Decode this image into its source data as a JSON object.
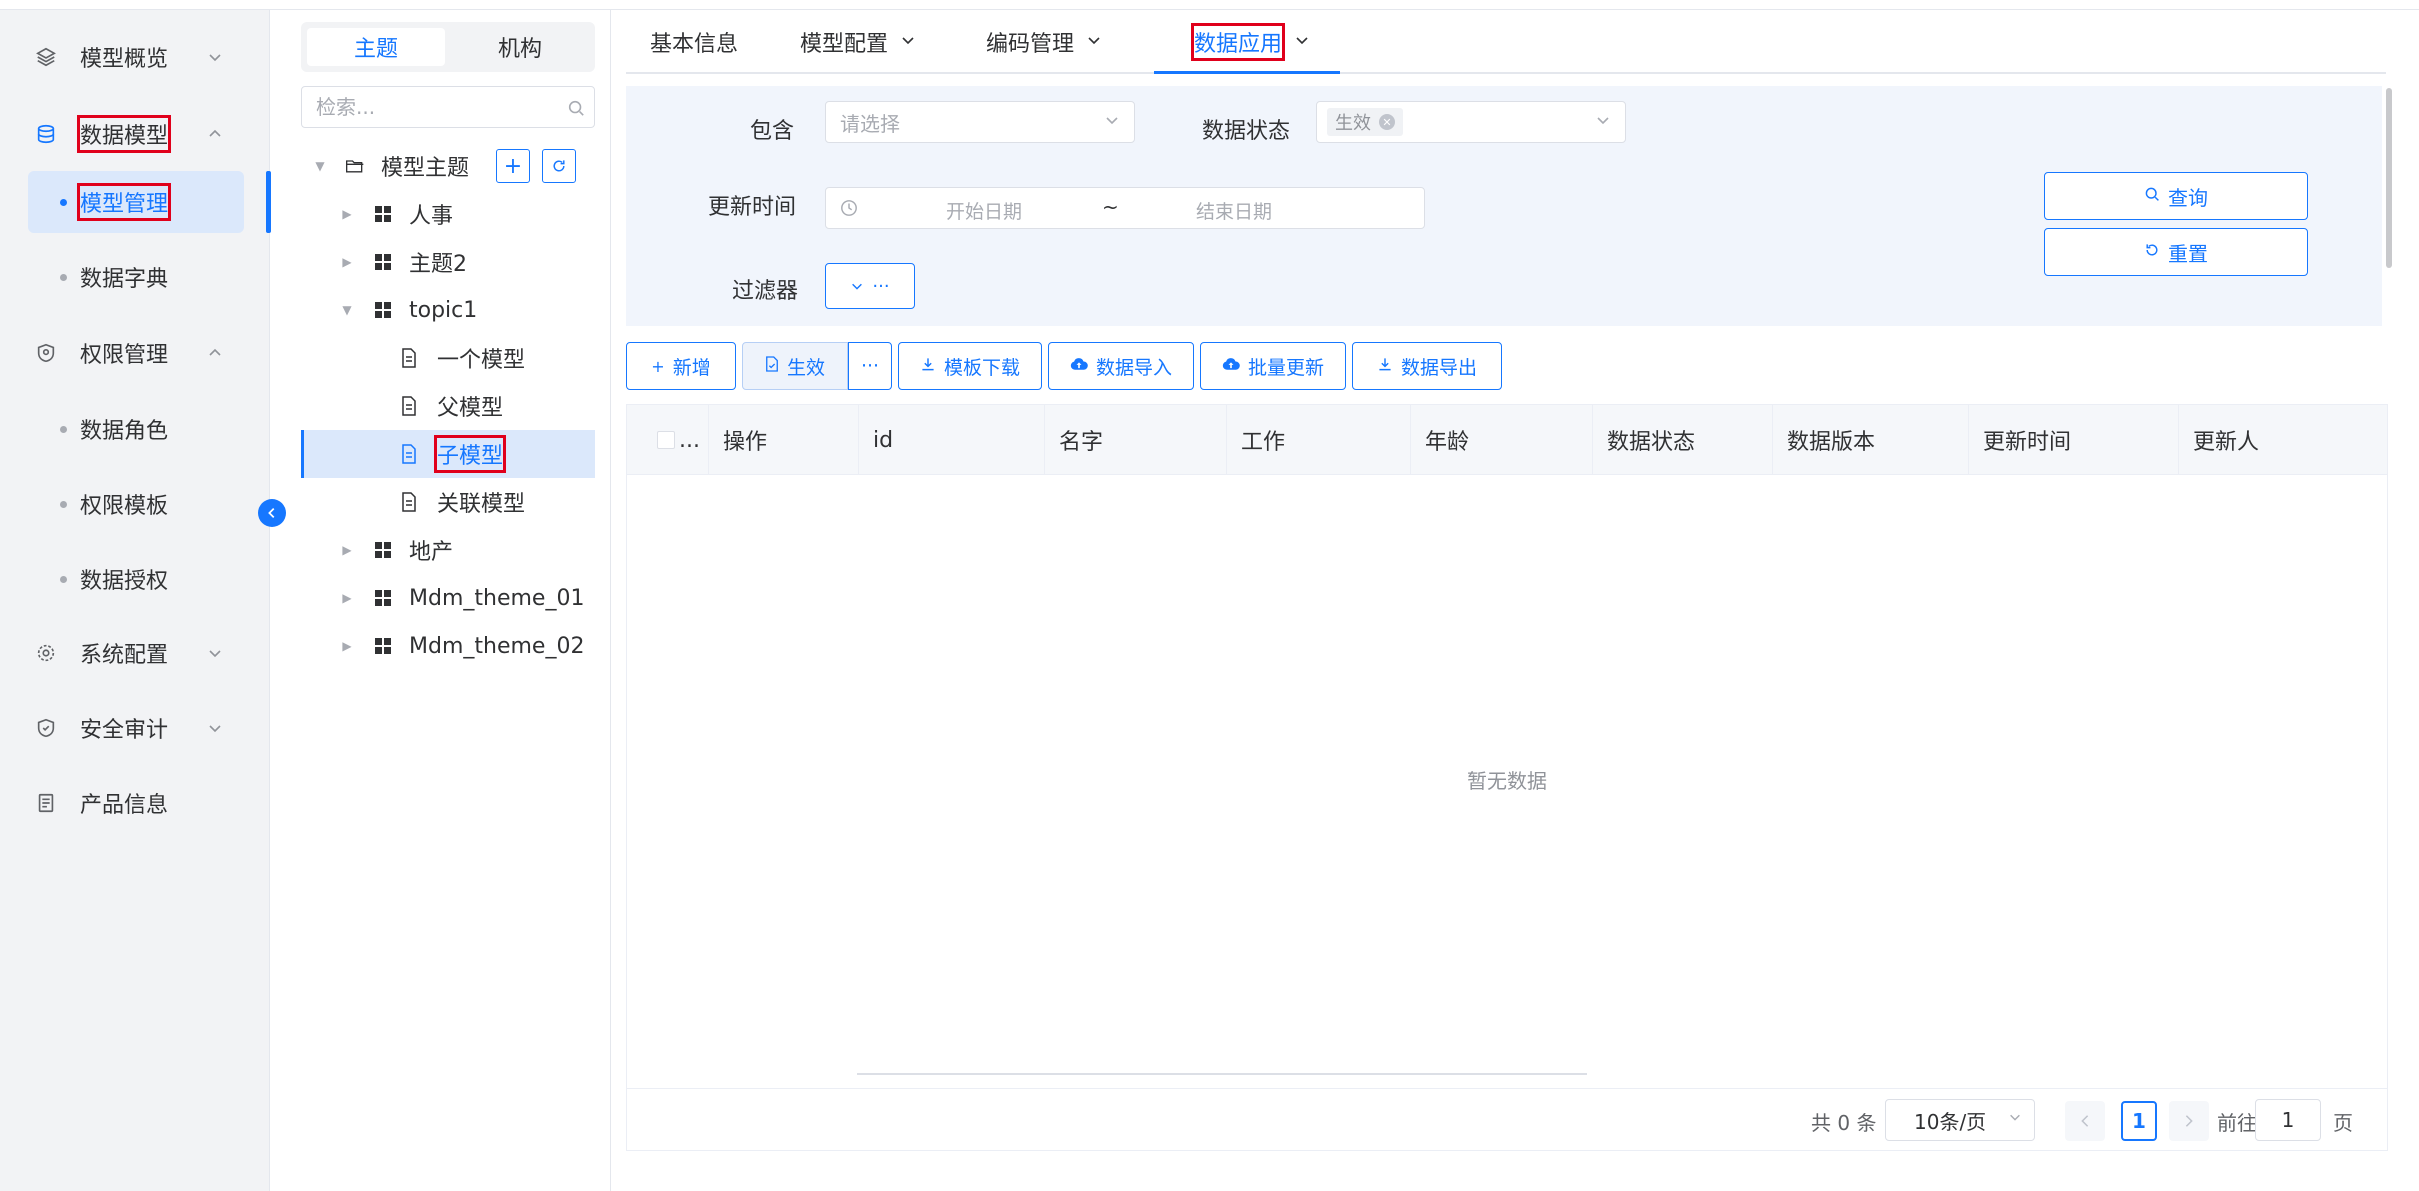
{
  "sidebar": {
    "menus": [
      {
        "label": "模型概览",
        "icon": "layers-icon",
        "expanded": false
      },
      {
        "label": "数据模型",
        "icon": "database-icon",
        "expanded": true
      },
      {
        "label": "权限管理",
        "icon": "shield-icon",
        "expanded": true
      },
      {
        "label": "系统配置",
        "icon": "gear-icon",
        "expanded": false
      },
      {
        "label": "安全审计",
        "icon": "audit-shield-icon",
        "expanded": false
      },
      {
        "label": "产品信息",
        "icon": "document-icon"
      }
    ],
    "data_model_items": [
      {
        "label": "模型管理",
        "active": true
      },
      {
        "label": "数据字典"
      }
    ],
    "permission_items": [
      {
        "label": "数据角色"
      },
      {
        "label": "权限模板"
      },
      {
        "label": "数据授权"
      }
    ]
  },
  "tree_panel": {
    "segments": [
      {
        "label": "主题",
        "active": true
      },
      {
        "label": "机构"
      }
    ],
    "search_placeholder": "检索...",
    "root": {
      "label": "模型主题"
    },
    "nodes": [
      {
        "label": "人事"
      },
      {
        "label": "主题2"
      },
      {
        "label": "topic1",
        "expanded": true
      },
      {
        "label": "一个模型"
      },
      {
        "label": "父模型"
      },
      {
        "label": "子模型",
        "selected": true
      },
      {
        "label": "关联模型"
      },
      {
        "label": "地产"
      },
      {
        "label": "Mdm_theme_01"
      },
      {
        "label": "Mdm_theme_02"
      }
    ]
  },
  "tabs": [
    {
      "label": "基本信息"
    },
    {
      "label": "模型配置",
      "dropdown": true
    },
    {
      "label": "编码管理",
      "dropdown": true
    },
    {
      "label": "数据应用",
      "dropdown": true,
      "active": true
    }
  ],
  "filter": {
    "include_label": "包含",
    "include_placeholder": "请选择",
    "status_label": "数据状态",
    "status_tag": "生效",
    "update_time_label": "更新时间",
    "start_date_placeholder": "开始日期",
    "range_separator": "~",
    "end_date_placeholder": "结束日期",
    "filter_label": "过滤器",
    "filter_button": "···",
    "query_button": "查询",
    "reset_button": "重置"
  },
  "toolbar": {
    "add": "新增",
    "activate": "生效",
    "more": "···",
    "template_download": "模板下载",
    "data_import": "数据导入",
    "batch_update": "批量更新",
    "data_export": "数据导出"
  },
  "table": {
    "select_all": "...",
    "columns": [
      "操作",
      "id",
      "名字",
      "工作",
      "年龄",
      "数据状态",
      "数据版本",
      "更新时间",
      "更新人"
    ],
    "empty_text": "暂无数据"
  },
  "pagination": {
    "total": "共 0 条",
    "page_size": "10条/页",
    "current_page": "1",
    "goto_label": "前往",
    "goto_value": "1",
    "page_suffix": "页"
  },
  "colors": {
    "primary": "#1677ff",
    "highlight_border": "#e0001b",
    "sidebar_bg": "#f2f3f5",
    "filter_bg": "#f1f5fc"
  }
}
